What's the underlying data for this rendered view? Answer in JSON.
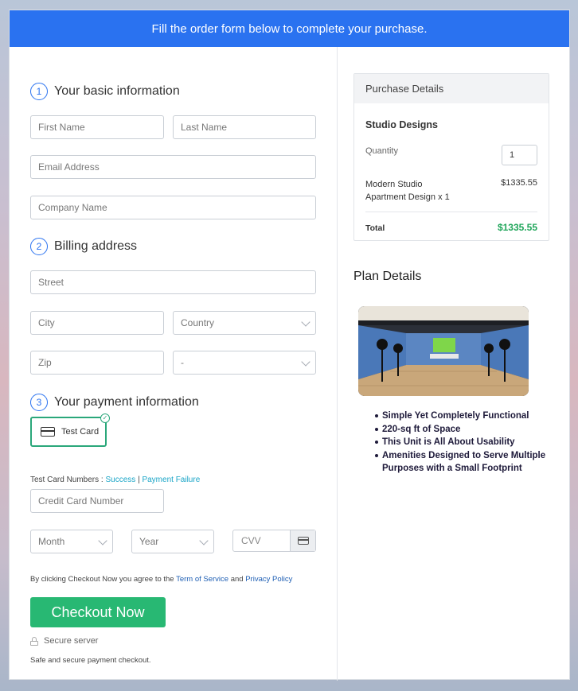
{
  "header": {
    "title": "Fill the order form below to complete your purchase."
  },
  "sections": {
    "basic": {
      "number": "1",
      "title": "Your basic information"
    },
    "billing": {
      "number": "2",
      "title": "Billing address"
    },
    "payment": {
      "number": "3",
      "title": "Your payment information"
    }
  },
  "fields": {
    "first_name": "First Name",
    "last_name": "Last Name",
    "email": "Email Address",
    "company": "Company Name",
    "street": "Street",
    "city": "City",
    "country": "Country",
    "zip": "Zip",
    "state": "-",
    "credit_card": "Credit Card Number",
    "month": "Month",
    "year": "Year",
    "cvv": "CVV"
  },
  "payment": {
    "option_label": "Test Card",
    "test_numbers_label": "Test Card Numbers :",
    "success_link": "Success",
    "separator": "|",
    "failure_link": "Payment Failure"
  },
  "terms": {
    "prefix": "By clicking Checkout Now you agree to the",
    "terms_link": "Term of Service",
    "and": "and",
    "privacy_link": "Privacy Policy"
  },
  "checkout": {
    "button_label": "Checkout Now",
    "secure_label": "Secure server",
    "footer_note": "Safe and secure payment checkout."
  },
  "purchase": {
    "title": "Purchase Details",
    "product": "Studio Designs",
    "quantity_label": "Quantity",
    "quantity_value": "1",
    "item_line1": "Modern Studio",
    "item_line2": "Apartment Design x 1",
    "item_price": "$1335.55",
    "total_label": "Total",
    "total_value": "$1335.55"
  },
  "plan": {
    "title": "Plan Details",
    "features": [
      "Simple Yet Completely Functional",
      "220-sq ft of Space",
      "This Unit is All About Usability",
      "Amenities Designed to Serve Multiple Purposes with a Small Footprint"
    ]
  },
  "colors": {
    "header_blue": "#2a72f0",
    "checkout_green": "#28b873",
    "total_green": "#21a65b",
    "link_teal": "#1aa5c7"
  }
}
